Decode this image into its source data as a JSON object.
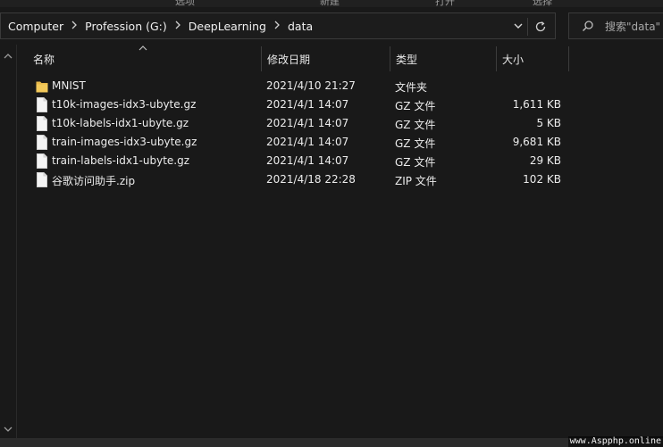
{
  "ribbon": {
    "cropped_labels": [
      "",
      "选项",
      "新建",
      "打开",
      "选择"
    ]
  },
  "address_bar": {
    "breadcrumbs": [
      "Computer",
      "Profession (G:)",
      "DeepLearning",
      "data"
    ]
  },
  "search": {
    "placeholder": "搜索\"data\""
  },
  "columns": {
    "name": "名称",
    "date": "修改日期",
    "type": "类型",
    "size": "大小"
  },
  "files": [
    {
      "name": "MNIST",
      "date": "2021/4/10 21:27",
      "type": "文件夹",
      "size": "",
      "icon": "folder-icon"
    },
    {
      "name": "t10k-images-idx3-ubyte.gz",
      "date": "2021/4/1 14:07",
      "type": "GZ 文件",
      "size": "1,611 KB",
      "icon": "file-icon"
    },
    {
      "name": "t10k-labels-idx1-ubyte.gz",
      "date": "2021/4/1 14:07",
      "type": "GZ 文件",
      "size": "5 KB",
      "icon": "file-icon"
    },
    {
      "name": "train-images-idx3-ubyte.gz",
      "date": "2021/4/1 14:07",
      "type": "GZ 文件",
      "size": "9,681 KB",
      "icon": "file-icon"
    },
    {
      "name": "train-labels-idx1-ubyte.gz",
      "date": "2021/4/1 14:07",
      "type": "GZ 文件",
      "size": "29 KB",
      "icon": "file-icon"
    },
    {
      "name": "谷歌访问助手.zip",
      "date": "2021/4/18 22:28",
      "type": "ZIP 文件",
      "size": "102 KB",
      "icon": "file-icon"
    }
  ],
  "watermark": "www.Aspphp.online",
  "colors": {
    "background": "#191919",
    "folder": "#e8b94a",
    "text": "#e8e8e8",
    "border": "#3a3a3a"
  }
}
